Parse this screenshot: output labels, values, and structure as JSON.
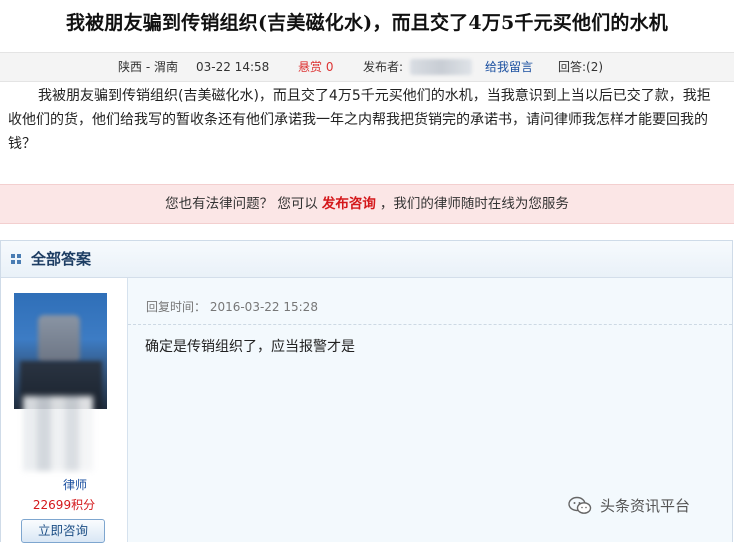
{
  "question": {
    "title": "我被朋友骗到传销组织(吉美磁化水)，而且交了4万5千元买他们的水机",
    "region": "陕西 - 渭南",
    "time": "03-22  14:58",
    "bounty": "悬赏 0",
    "poster_label": "发布者:",
    "leave_message": "给我留言",
    "replies": "回答:(2)",
    "body": "我被朋友骗到传销组织(吉美磁化水)，而且交了4万5千元买他们的水机，当我意识到上当以后已交了款，我拒收他们的货，他们给我写的暂收条还有他们承诺我一年之内帮我把货销完的承诺书，请问律师我怎样才能要回我的钱？"
  },
  "consult_bar": {
    "prefix": "您也有法律问题？  您可以",
    "link": "发布咨询",
    "suffix": "，我们的律师随时在线为您服务"
  },
  "answers": {
    "title": "全部答案",
    "items": [
      {
        "lawyer_name": "律师",
        "points": "22699积分",
        "consult_button": "立即咨询",
        "reply_time": "回复时间：  2016-03-22  15:28",
        "reply_text": "确定是传销组织了，应当报警才是"
      }
    ]
  },
  "watermark": {
    "text": "头条资讯平台",
    "icon": "wechat-icon"
  },
  "colors": {
    "accent_red": "#d4181b",
    "link_blue": "#1a4fa0",
    "consult_bg": "#fbe6e6",
    "reply_bg": "#f3f9fd"
  }
}
